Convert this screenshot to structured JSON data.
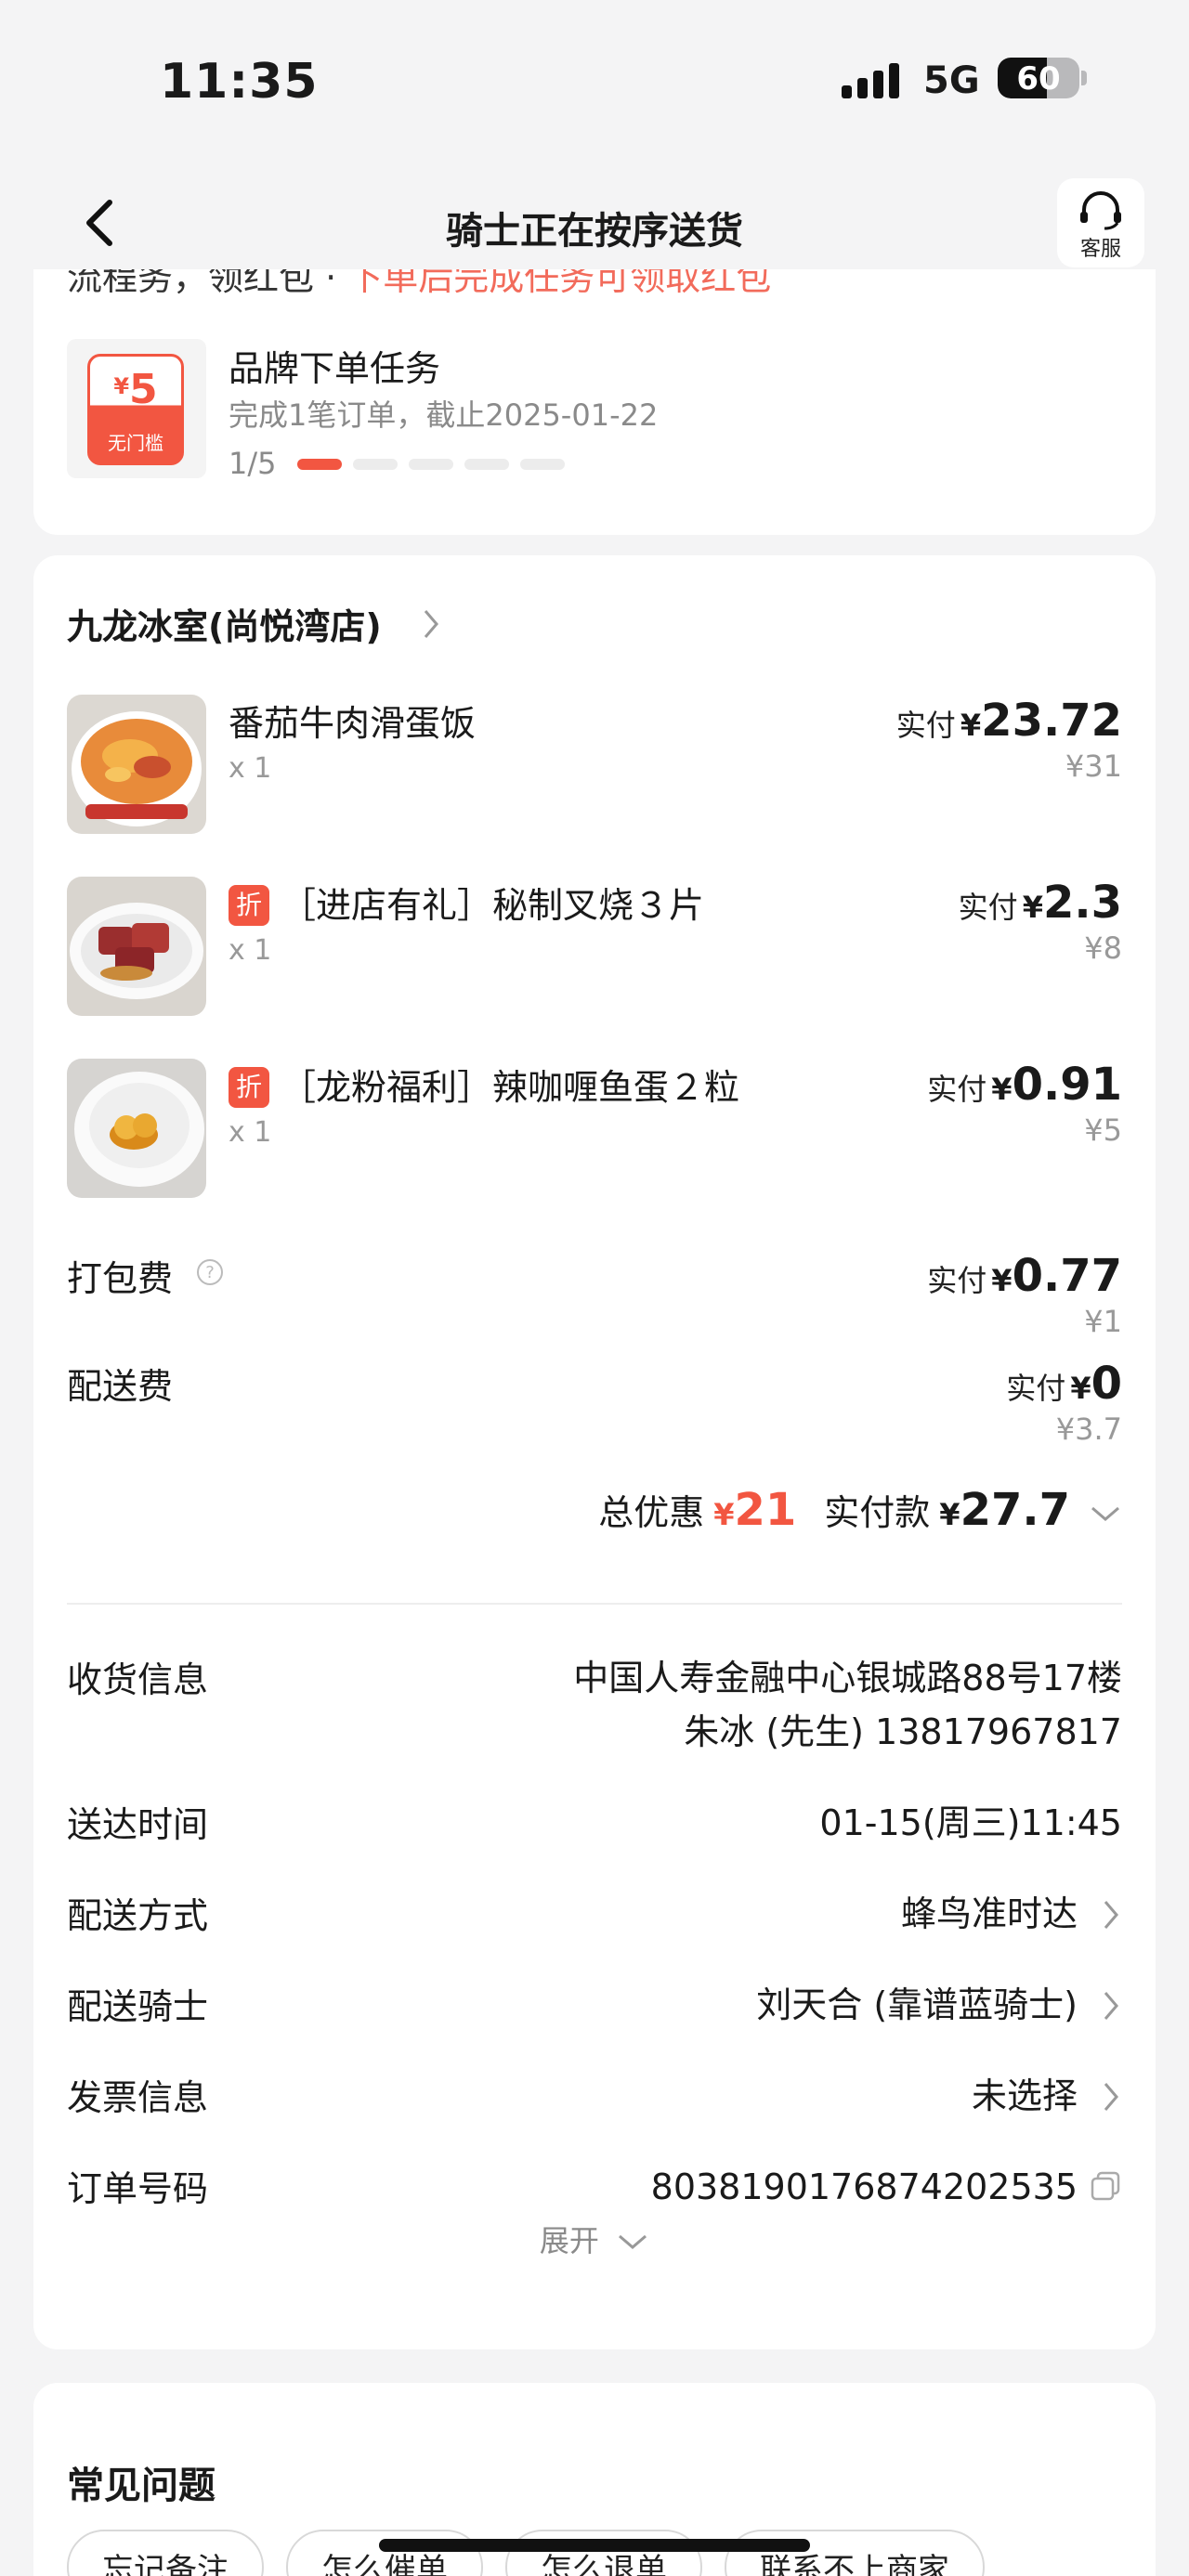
{
  "status_bar": {
    "time": "11:35",
    "network": "5G",
    "battery": "60",
    "battery_level": 0.6
  },
  "nav": {
    "title": "骑士正在按序送货",
    "service_label": "客服"
  },
  "task_card": {
    "cut_text_a": "流程务，领红包 · ",
    "cut_text_b": "下单后完成任务可领取红包",
    "coupon_symbol": "¥",
    "coupon_amount": "5",
    "coupon_condition": "无门槛",
    "title": "品牌下单任务",
    "desc": "完成1笔订单，截止2025-01-22",
    "progress_text": "1/5",
    "progress_done": 1,
    "progress_total": 5
  },
  "order": {
    "shop_name": "九龙冰室(尚悦湾店)",
    "paid_label": "实付",
    "yen": "¥",
    "items": [
      {
        "flag": "",
        "name": "番茄牛肉滑蛋饭",
        "qty": "x 1",
        "paid": "23.72",
        "orig": "¥31"
      },
      {
        "flag": "折",
        "name": "［进店有礼］秘制叉烧３片",
        "qty": "x 1",
        "paid": "2.3",
        "orig": "¥8"
      },
      {
        "flag": "折",
        "name": "［龙粉福利］辣咖喱鱼蛋２粒",
        "qty": "x 1",
        "paid": "0.91",
        "orig": "¥5"
      }
    ],
    "fees": [
      {
        "label": "打包费",
        "paid": "0.77",
        "orig": "¥1"
      },
      {
        "label": "配送费",
        "paid": "0",
        "orig": "¥3.7"
      }
    ],
    "summary": {
      "discount_label": "总优惠",
      "discount": "21",
      "total_label": "实付款",
      "total": "27.7"
    },
    "info": {
      "address_label": "收货信息",
      "address_line1": "中国人寿金融中心银城路88号17楼",
      "address_line2": "朱冰 (先生) 13817967817",
      "time_label": "送达时间",
      "time_value": "01-15(周三)11:45",
      "method_label": "配送方式",
      "method_value": "蜂鸟准时达",
      "rider_label": "配送骑士",
      "rider_value": "刘天合 (靠谱蓝骑士)",
      "invoice_label": "发票信息",
      "invoice_value": "未选择",
      "order_no_label": "订单号码",
      "order_no_value": "8038190176874202535"
    },
    "expand_label": "展开"
  },
  "faq": {
    "title": "常见问题",
    "chips": [
      "忘记备注",
      "怎么催单",
      "怎么退单",
      "联系不上商家"
    ]
  },
  "colors": {
    "accent": "#f25641",
    "muted": "#999999",
    "background": "#f4f4f5"
  }
}
